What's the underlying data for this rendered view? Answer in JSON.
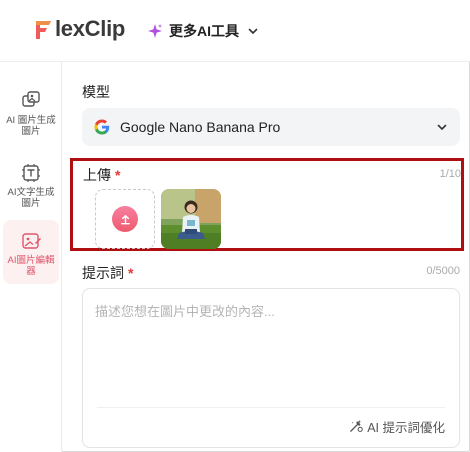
{
  "header": {
    "logo_text": "lexClip",
    "logo_letter": "F",
    "ai_tools_label": "更多AI工具"
  },
  "sidebar": {
    "items": [
      {
        "label": "AI 圖片生成圖片",
        "icon": "image-to-image-icon",
        "active": false
      },
      {
        "label": "AI文字生成圖片",
        "icon": "text-to-image-icon",
        "active": false
      },
      {
        "label": "AI圖片編輯器",
        "icon": "image-editor-icon",
        "active": true
      }
    ]
  },
  "model": {
    "label": "模型",
    "selected": "Google Nano Banana Pro",
    "icon": "google-icon"
  },
  "upload": {
    "label": "上傳",
    "required_mark": "*",
    "count": "1/10",
    "upload_icon": "upload-icon",
    "thumbnail_icon": "uploaded-photo-thumbnail"
  },
  "prompt": {
    "label": "提示詞",
    "required_mark": "*",
    "count": "0/5000",
    "placeholder": "描述您想在圖片中更改的內容...",
    "value": "",
    "optimize_label": "AI 提示詞優化",
    "optimize_icon": "magic-wand-icon"
  },
  "colors": {
    "accent": "#e0556b",
    "highlight_border": "#b00f12",
    "required": "#e53935"
  }
}
